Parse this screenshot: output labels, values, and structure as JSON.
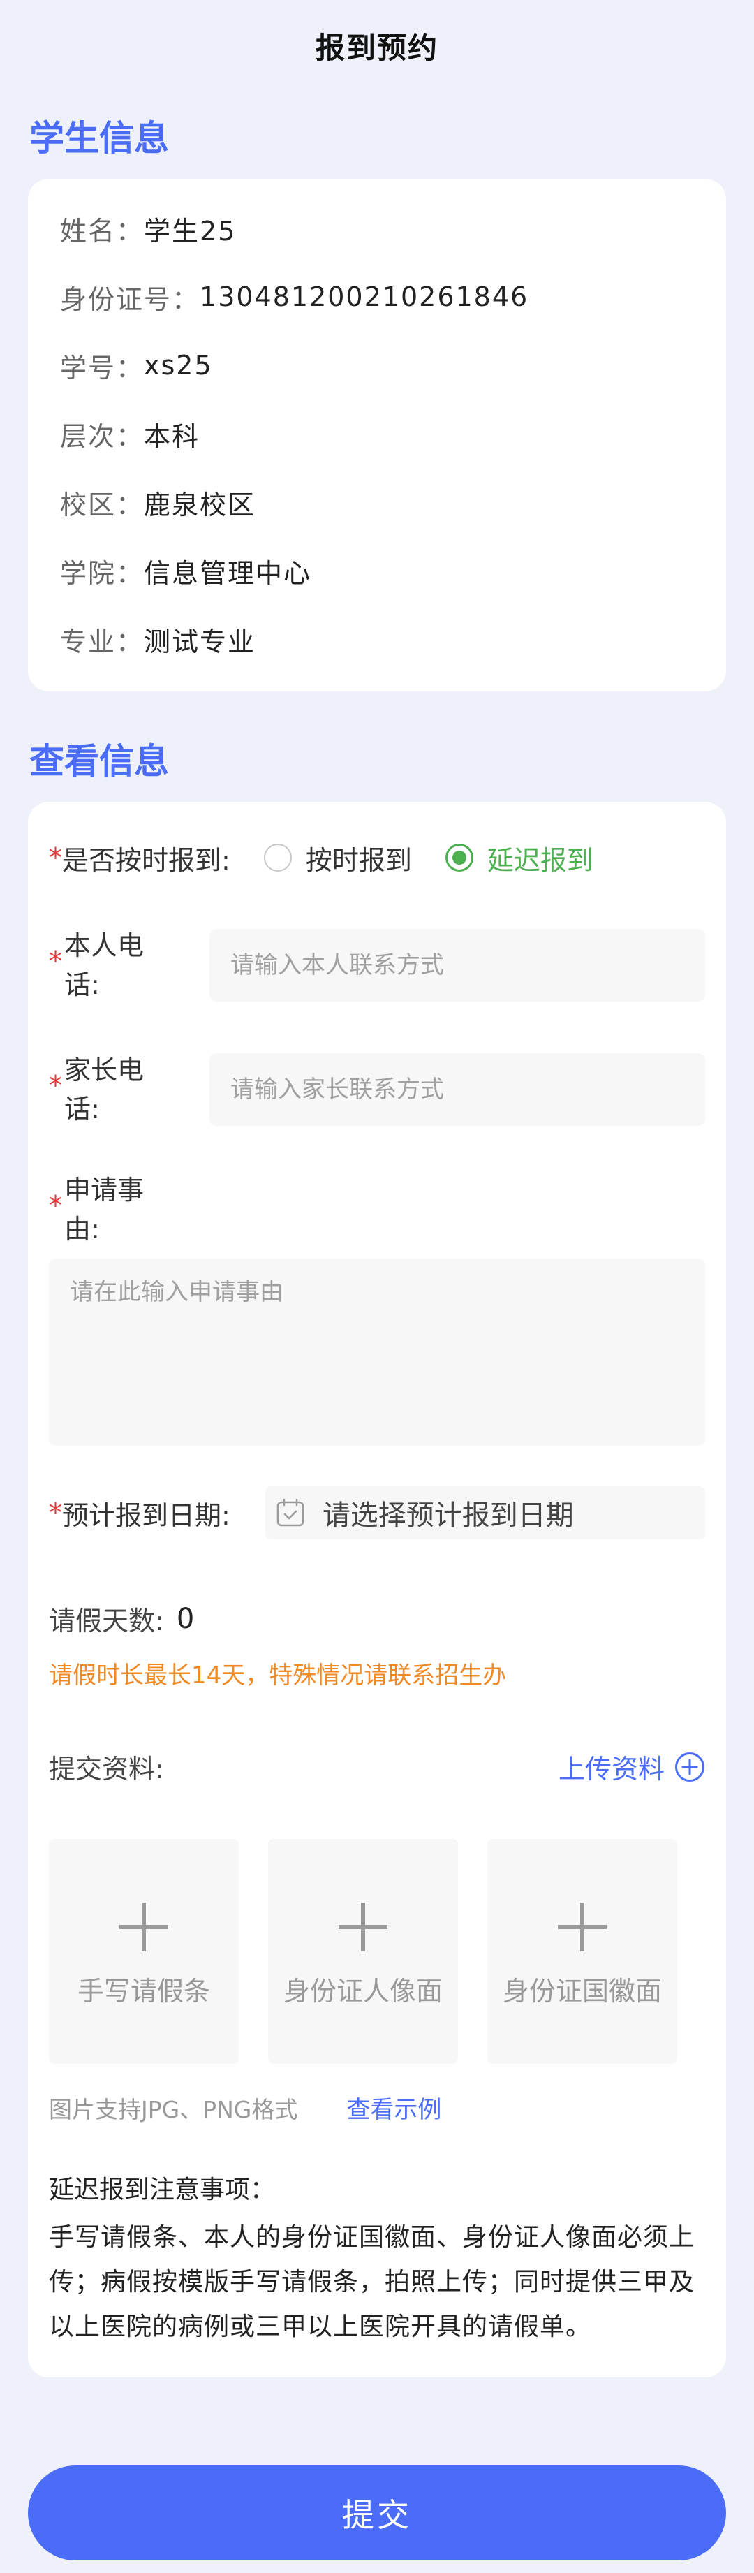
{
  "header": {
    "title": "报到预约"
  },
  "student_section": {
    "title": "学生信息",
    "rows": [
      {
        "key": "姓名：",
        "value": "学生25"
      },
      {
        "key": "身份证号：",
        "value": "130481200210261846"
      },
      {
        "key": "学号：",
        "value": "xs25"
      },
      {
        "key": "层次：",
        "value": "本科"
      },
      {
        "key": "校区：",
        "value": "鹿泉校区"
      },
      {
        "key": "学院：",
        "value": "信息管理中心"
      },
      {
        "key": "专业：",
        "value": "测试专业"
      }
    ]
  },
  "view_section": {
    "title": "查看信息",
    "required_mark": "*",
    "ontime": {
      "label": "是否按时报到:",
      "options": [
        "按时报到",
        "延迟报到"
      ],
      "selected": "延迟报到"
    },
    "self_phone": {
      "label": "本人电话:",
      "placeholder": "请输入本人联系方式"
    },
    "parent_phone": {
      "label": "家长电话:",
      "placeholder": "请输入家长联系方式"
    },
    "reason": {
      "label": "申请事由:",
      "placeholder": "请在此输入申请事由"
    },
    "date": {
      "label": "预计报到日期:",
      "placeholder": "请选择预计报到日期"
    },
    "days": {
      "label": "请假天数:",
      "value": "0"
    },
    "warning": "请假时长最长14天，特殊情况请联系招生办",
    "upload": {
      "label": "提交资料:",
      "button": "上传资料",
      "tiles": [
        "手写请假条",
        "身份证人像面",
        "身份证国徽面"
      ],
      "format_hint": "图片支持JPG、PNG格式",
      "example_link": "查看示例"
    },
    "notice": {
      "title": "延迟报到注意事项：",
      "body": "手写请假条、本人的身份证国徽面、身份证人像面必须上传；病假按模版手写请假条，拍照上传；同时提供三甲及以上医院的病例或三甲以上医院开具的请假单。"
    }
  },
  "submit_label": "提交",
  "colors": {
    "accent": "#4a6cf7",
    "selected_radio": "#4caf50",
    "warning": "#f08a24",
    "required": "#e23a3a",
    "background": "#eff1fa"
  }
}
